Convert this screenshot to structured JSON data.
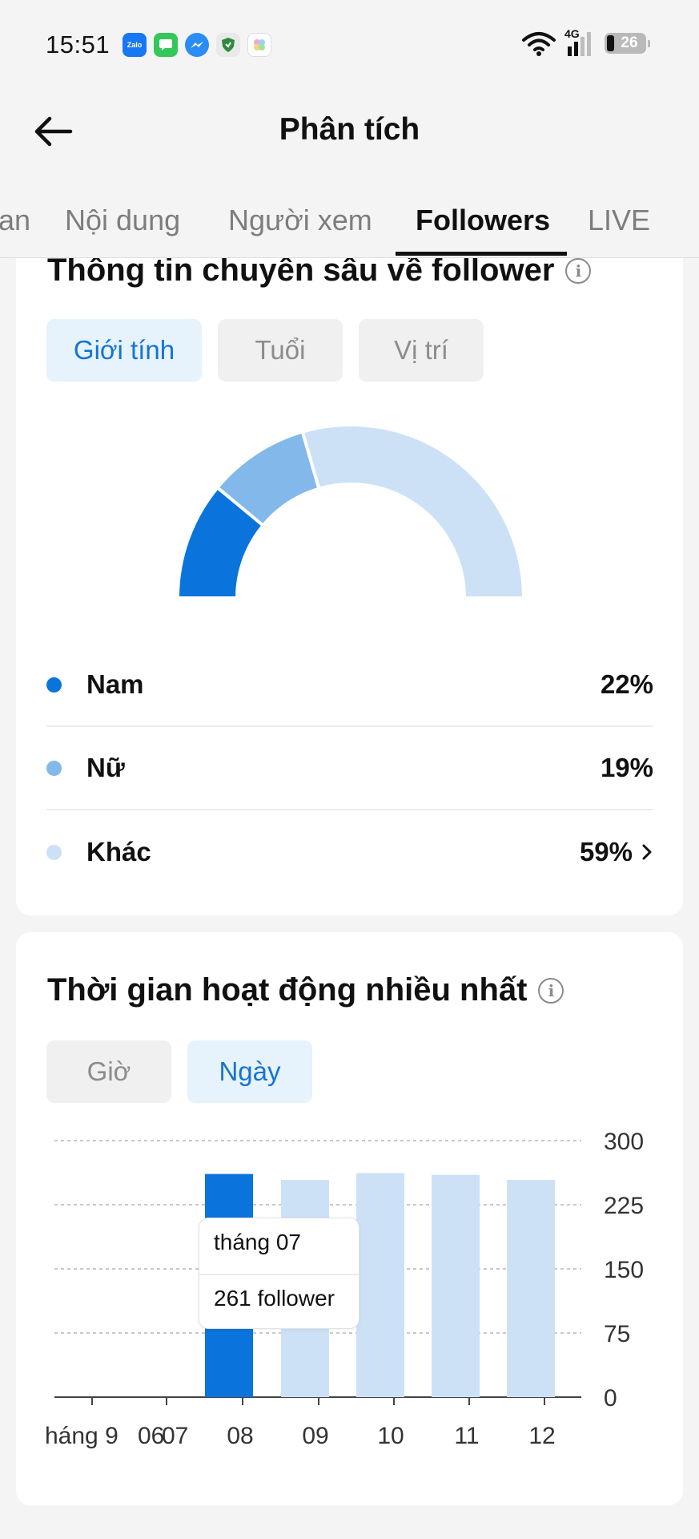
{
  "status_bar": {
    "time": "15:51",
    "network": "4G",
    "battery": "26",
    "app_icons": [
      "zalo-icon",
      "messages-icon",
      "messenger-icon",
      "shield-app-icon",
      "gallery-app-icon"
    ]
  },
  "header": {
    "title": "Phân tích"
  },
  "tabs": [
    {
      "label": "an",
      "active": false
    },
    {
      "label": "Nội dung",
      "active": false
    },
    {
      "label": "Người xem",
      "active": false
    },
    {
      "label": "Followers",
      "active": true
    },
    {
      "label": "LIVE",
      "active": false
    }
  ],
  "insights": {
    "title": "Thông tin chuyên sâu về follower",
    "filters": [
      {
        "label": "Giới tính",
        "active": true
      },
      {
        "label": "Tuổi",
        "active": false
      },
      {
        "label": "Vị trí",
        "active": false
      }
    ],
    "gender": [
      {
        "label": "Nam",
        "value": "22%",
        "percent": 22,
        "color": "#0a74dc"
      },
      {
        "label": "Nữ",
        "value": "19%",
        "percent": 19,
        "color": "#82b8ea"
      },
      {
        "label": "Khác",
        "value": "59%",
        "percent": 59,
        "color": "#cce1f6"
      }
    ]
  },
  "activity": {
    "title": "Thời gian hoạt động nhiều nhất",
    "filters": [
      {
        "label": "Giờ",
        "active": false
      },
      {
        "label": "Ngày",
        "active": true
      }
    ],
    "tooltip": {
      "line1": "tháng 07",
      "line2": "261 follower"
    }
  },
  "chart_data": {
    "type": "bar",
    "categories": [
      "06",
      "07",
      "08",
      "09",
      "10",
      "11",
      "12"
    ],
    "x_tick_labels": [
      "háng 9",
      "06",
      "07",
      "08",
      "09",
      "10",
      "11",
      "12"
    ],
    "values": [
      0,
      261,
      254,
      262,
      260,
      254,
      0
    ],
    "highlighted_index": 1,
    "y_ticks": [
      "300",
      "225",
      "150",
      "75",
      "0"
    ],
    "ylim": [
      0,
      300
    ],
    "grid": true,
    "colors": {
      "highlight": "#0a74dc",
      "normal": "#cce1f6"
    }
  }
}
